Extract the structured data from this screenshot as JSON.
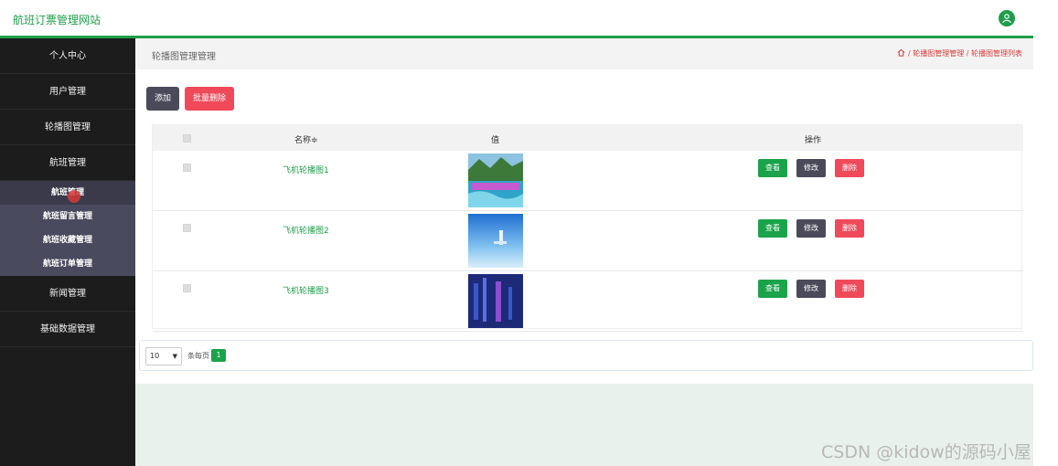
{
  "header": {
    "title": "航班订票管理网站",
    "avatar_icon": "user-icon"
  },
  "sidebar": {
    "items_top": [
      {
        "label": "个人中心"
      },
      {
        "label": "用户管理"
      },
      {
        "label": "轮播图管理"
      },
      {
        "label": "航班管理"
      }
    ],
    "subitems": [
      {
        "label": "航班管理"
      },
      {
        "label": "航班留言管理"
      },
      {
        "label": "航班收藏管理"
      },
      {
        "label": "航班订单管理"
      }
    ],
    "items_bottom": [
      {
        "label": "新闻管理"
      },
      {
        "label": "基础数据管理"
      }
    ]
  },
  "breadcrumb": {
    "page_title": "轮播图管理管理",
    "trail": "/ 轮播图管理管理 / 轮播图管理列表"
  },
  "toolbar": {
    "add_label": "添加",
    "batch_delete_label": "批量删除"
  },
  "table": {
    "headers": {
      "name": "名称≑",
      "value": "值",
      "actions": "操作"
    },
    "rows": [
      {
        "name": "飞机轮播图1",
        "image": "landscape-banner-thumbnail",
        "view": "查看",
        "edit": "修改",
        "delete": "删除"
      },
      {
        "name": "飞机轮播图2",
        "image": "sky-blue-thumbnail",
        "view": "查看",
        "edit": "修改",
        "delete": "删除"
      },
      {
        "name": "飞机轮播图3",
        "image": "night-city-thumbnail",
        "view": "查看",
        "edit": "修改",
        "delete": "删除"
      }
    ]
  },
  "pagination": {
    "page_size": "10",
    "per_page_label": "条每页",
    "current_page": "1"
  },
  "watermark": "CSDN @kidow的源码小屋",
  "colors": {
    "accent": "#1e9e4a",
    "danger": "#f04a5a",
    "dark_button": "#4a4a5a"
  }
}
